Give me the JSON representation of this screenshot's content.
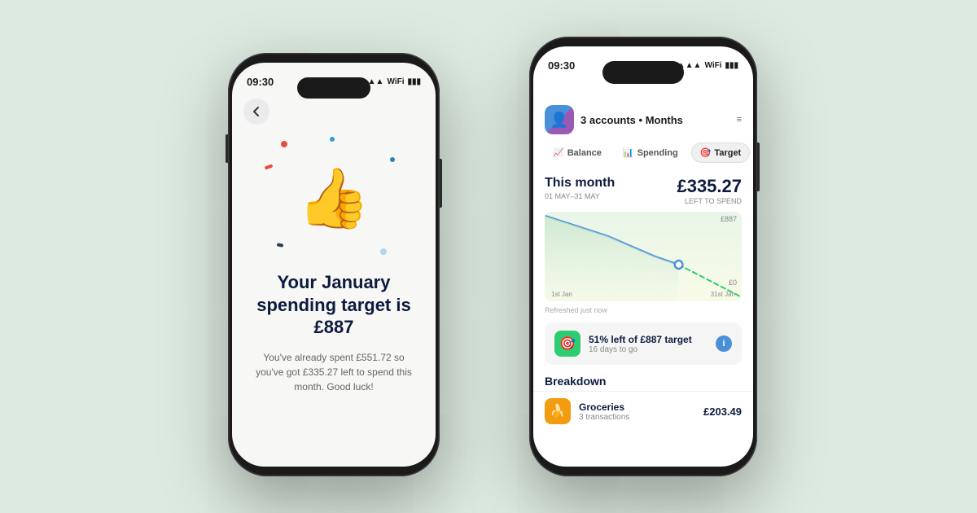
{
  "background": "#ddeae0",
  "left_phone": {
    "status_time": "09:30",
    "heading": "Your January spending target is £887",
    "subtext": "You've already spent £551.72 so you've got £335.27 left to spend this month. Good luck!"
  },
  "right_phone": {
    "status_time": "09:30",
    "header": {
      "accounts_label": "3 accounts • Months",
      "filter_icon": "≡"
    },
    "tabs": [
      {
        "label": "Balance",
        "icon": "📈",
        "active": false
      },
      {
        "label": "Spending",
        "icon": "📊",
        "active": false
      },
      {
        "label": "Target",
        "icon": "🎯",
        "active": true
      }
    ],
    "this_month": {
      "label": "This month",
      "date_range": "01 MAY–31 MAY",
      "amount": "£335.27",
      "amount_label": "LEFT TO SPEND"
    },
    "chart": {
      "y_top": "£887",
      "y_bottom": "£0",
      "x_left": "1st Jan",
      "x_right": "31st Jan"
    },
    "refreshed": "Refreshed just now",
    "target_row": {
      "icon": "🎯",
      "title": "51% left of £887 target",
      "days": "16 days to go"
    },
    "breakdown_label": "Breakdown",
    "groceries": {
      "name": "Groceries",
      "count": "3 transactions",
      "amount": "£203.49"
    }
  }
}
